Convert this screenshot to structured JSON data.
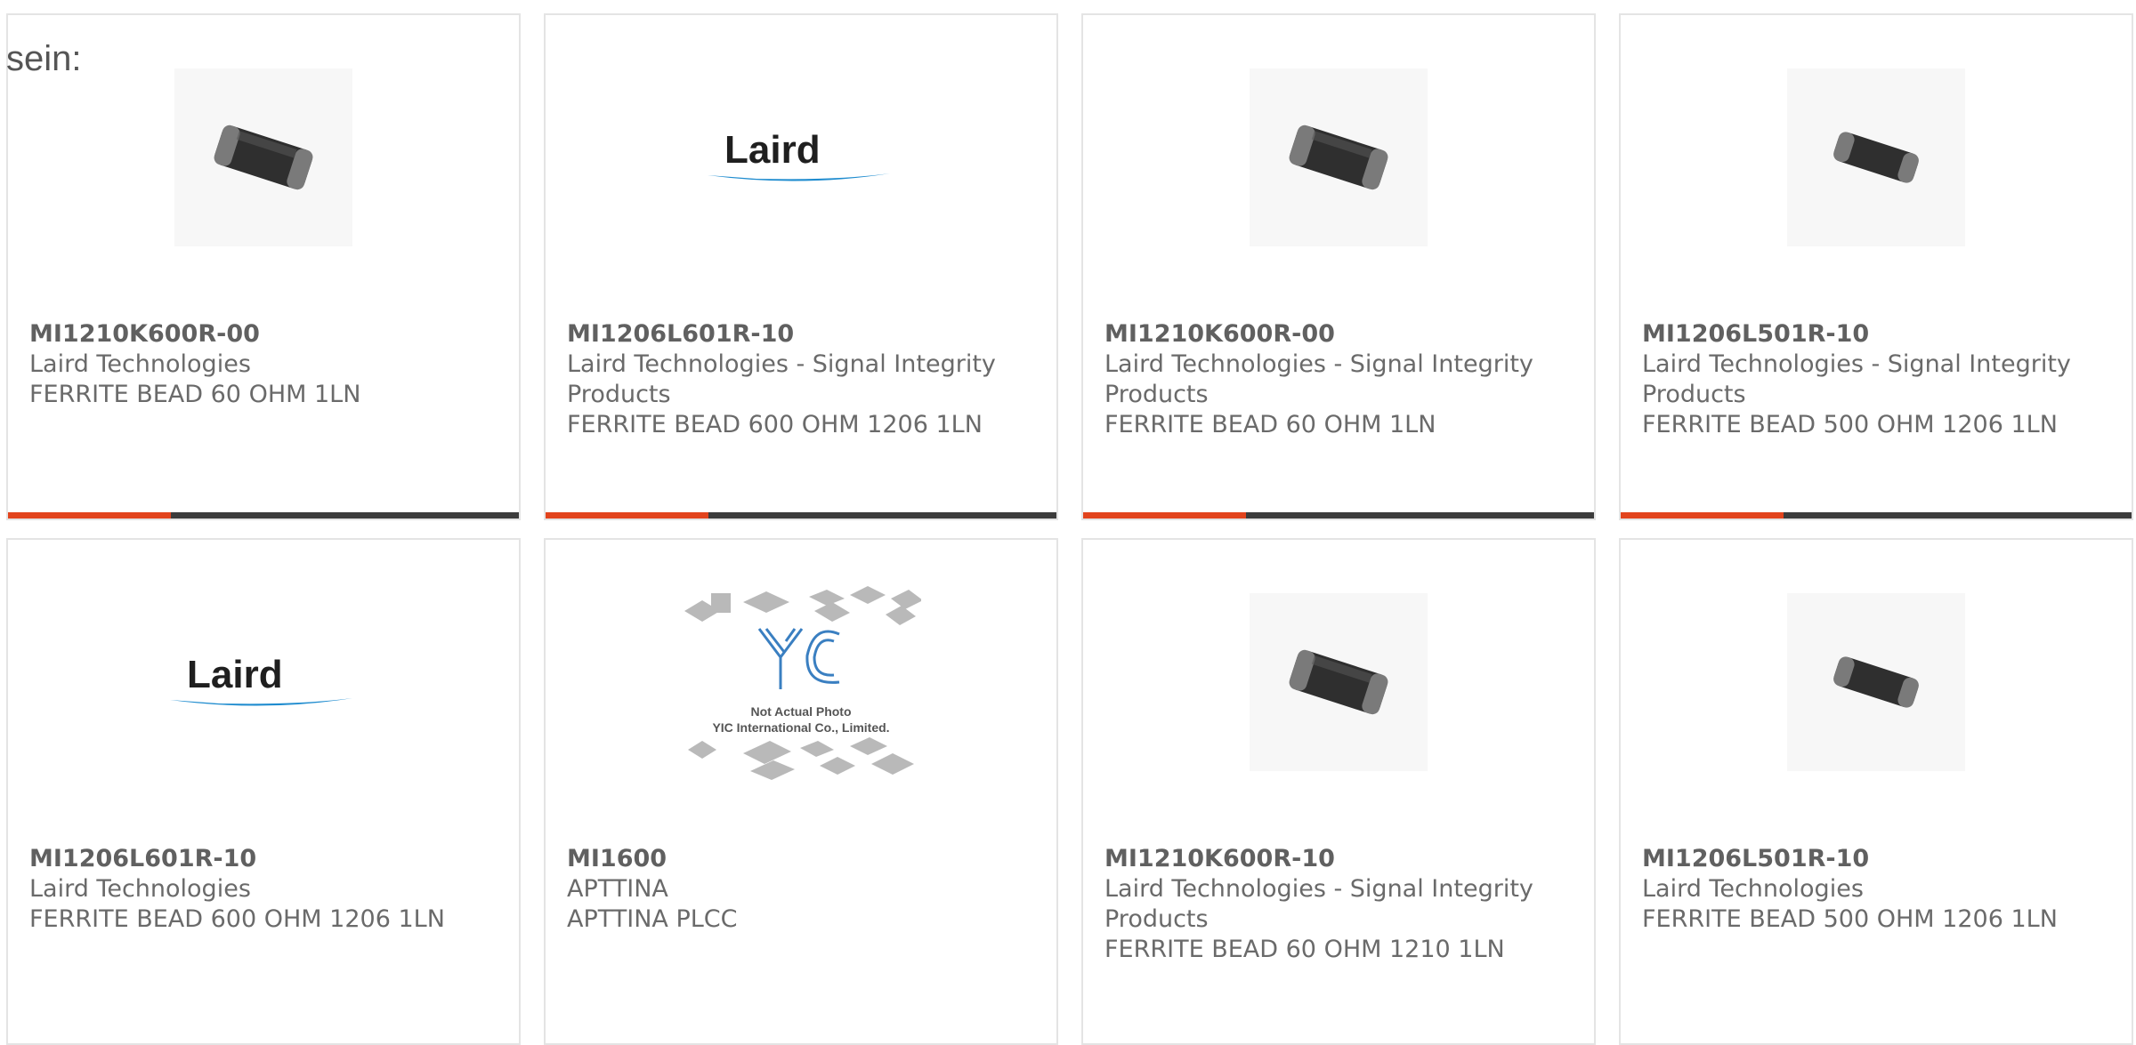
{
  "lead_text": "sein:",
  "colors": {
    "accent": "#e2441d",
    "bar": "#3c3c3c",
    "border": "#e4e4e4"
  },
  "cards": [
    {
      "part": "MI1210K600R-00",
      "manufacturer": "Laird Technologies",
      "description": "FERRITE BEAD 60 OHM 1LN",
      "image": "ferrite-chip-icon"
    },
    {
      "part": "MI1206L601R-10",
      "manufacturer": "Laird Technologies - Signal Integrity Products",
      "description": "FERRITE BEAD 600 OHM 1206 1LN",
      "image": "laird-logo",
      "logo_text": "Laird"
    },
    {
      "part": "MI1210K600R-00",
      "manufacturer": "Laird Technologies - Signal Integrity Products",
      "description": "FERRITE BEAD 60 OHM 1LN",
      "image": "ferrite-chip-icon"
    },
    {
      "part": "MI1206L501R-10",
      "manufacturer": "Laird Technologies - Signal Integrity Products",
      "description": "FERRITE BEAD 500 OHM 1206 1LN",
      "image": "ferrite-chip-icon"
    },
    {
      "part": "MI1206L601R-10",
      "manufacturer": "Laird Technologies",
      "description": "FERRITE BEAD 600 OHM 1206 1LN",
      "image": "laird-logo",
      "logo_text": "Laird"
    },
    {
      "part": "MI1600",
      "manufacturer": "APTTINA",
      "description": "APTTINA PLCC",
      "image": "yic-placeholder",
      "placeholder_line1": "Not Actual Photo",
      "placeholder_line2": "YIC International Co., Limited."
    },
    {
      "part": "MI1210K600R-10",
      "manufacturer": "Laird Technologies - Signal Integrity Products",
      "description": "FERRITE BEAD 60 OHM 1210 1LN",
      "image": "ferrite-chip-icon"
    },
    {
      "part": "MI1206L501R-10",
      "manufacturer": "Laird Technologies",
      "description": "FERRITE BEAD 500 OHM 1206 1LN",
      "image": "ferrite-chip-icon"
    }
  ]
}
